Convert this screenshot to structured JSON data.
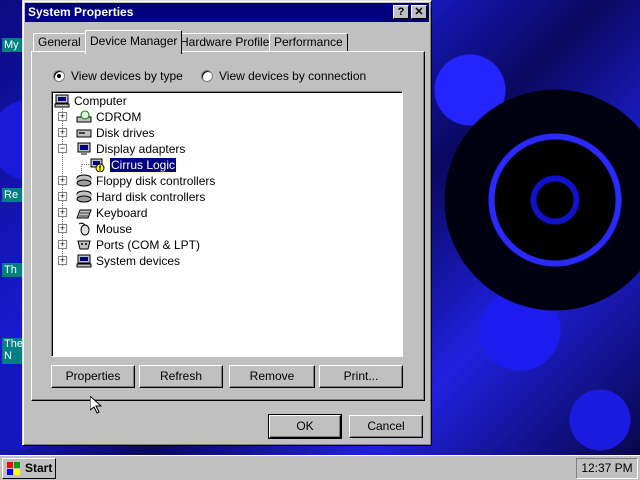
{
  "desktop": {
    "labels": [
      "My",
      "Re",
      "Th",
      "The N"
    ]
  },
  "window": {
    "title": "System Properties",
    "help_label": "?",
    "close_label": "✕"
  },
  "tabs": [
    {
      "label": "General",
      "active": false
    },
    {
      "label": "Device Manager",
      "active": true
    },
    {
      "label": "Hardware Profiles",
      "active": false
    },
    {
      "label": "Performance",
      "active": false
    }
  ],
  "view_options": {
    "by_type": {
      "label": "View devices by type",
      "selected": true
    },
    "by_connection": {
      "label": "View devices by connection",
      "selected": false
    }
  },
  "tree": {
    "root": "Computer",
    "items": [
      {
        "label": "CDROM",
        "icon": "cdrom-icon",
        "expander": "+"
      },
      {
        "label": "Disk drives",
        "icon": "disk-drive-icon",
        "expander": "+"
      },
      {
        "label": "Display adapters",
        "icon": "monitor-icon",
        "expander": "−"
      },
      {
        "label": "Floppy disk controllers",
        "icon": "controller-icon",
        "expander": "+"
      },
      {
        "label": "Hard disk controllers",
        "icon": "controller-icon",
        "expander": "+"
      },
      {
        "label": "Keyboard",
        "icon": "keyboard-icon",
        "expander": "+"
      },
      {
        "label": "Mouse",
        "icon": "mouse-icon",
        "expander": "+"
      },
      {
        "label": "Ports (COM & LPT)",
        "icon": "port-icon",
        "expander": "+"
      },
      {
        "label": "System devices",
        "icon": "computer-icon",
        "expander": "+"
      }
    ],
    "child": {
      "label": "Cirrus Logic",
      "icon": "warning-icon"
    }
  },
  "buttons": {
    "properties": "Properties",
    "refresh": "Refresh",
    "remove": "Remove",
    "print": "Print...",
    "ok": "OK",
    "cancel": "Cancel"
  },
  "taskbar": {
    "start_label": "Start",
    "clock": "12:37 PM"
  },
  "colors": {
    "titlebar": "#000080",
    "face": "#c0c0c0",
    "desktop_accent": "#1b1bd6"
  }
}
